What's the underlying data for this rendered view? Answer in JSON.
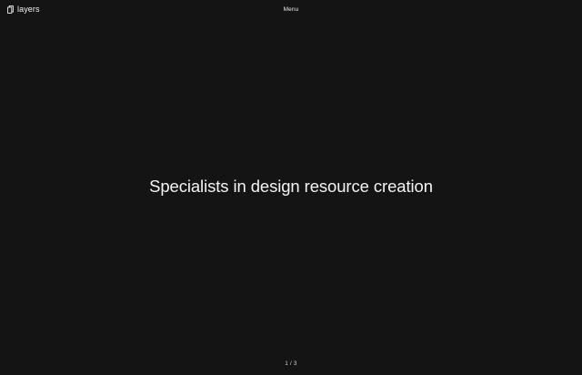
{
  "header": {
    "logo_text": "layers",
    "logo_icon": "layers-icon",
    "menu_label": "Menu"
  },
  "hero": {
    "title": "Specialists in design resource creation"
  },
  "pager": {
    "text": "1 / 3"
  },
  "colors": {
    "background": "#141414",
    "text": "#f2f2f2"
  }
}
